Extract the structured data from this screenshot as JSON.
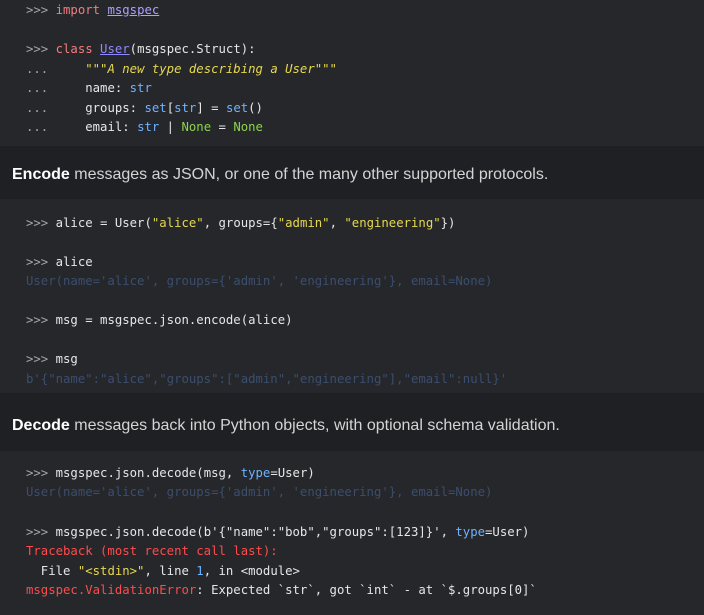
{
  "block1": {
    "l1": [
      ">>> ",
      "import ",
      "msgspec"
    ],
    "l2": [
      ">>> ",
      "class ",
      "User",
      "(msgspec.Struct):"
    ],
    "l3": [
      "...     ",
      "\"\"\"A new type describing a User\"\"\""
    ],
    "l4": [
      "...     ",
      "name: ",
      "str"
    ],
    "l5": [
      "...     ",
      "groups: ",
      "set",
      "[",
      "str",
      "] = ",
      "set",
      "()"
    ],
    "l6": [
      "...     ",
      "email: ",
      "str",
      " | ",
      "None",
      " = ",
      "None"
    ]
  },
  "prose1": {
    "bold": "Encode",
    "rest": " messages as JSON, or one of the many other supported protocols."
  },
  "block2": {
    "l1": [
      ">>> ",
      "alice = User(",
      "\"alice\"",
      ", groups={",
      "\"admin\"",
      ", ",
      "\"engineering\"",
      "})"
    ],
    "l2": [
      ">>> ",
      "alice"
    ],
    "l3": "User(name='alice', groups={'admin', 'engineering'}, email=None)",
    "l4": [
      ">>> ",
      "msg = msgspec.json.encode(alice)"
    ],
    "l5": [
      ">>> ",
      "msg"
    ],
    "l6": "b'{\"name\":\"alice\",\"groups\":[\"admin\",\"engineering\"],\"email\":null}'"
  },
  "prose2": {
    "bold": "Decode",
    "rest": " messages back into Python objects, with optional schema validation."
  },
  "block3": {
    "l1": [
      ">>> ",
      "msgspec.json.decode(msg, ",
      "type",
      "=User)"
    ],
    "l2": "User(name='alice', groups={'admin', 'engineering'}, email=None)",
    "l3": [
      ">>> ",
      "msgspec.json.decode(b'{\"name\":\"bob\",\"groups\":[123]}', ",
      "type",
      "=User)"
    ],
    "l4": "Traceback (most recent call last):",
    "l5": [
      "  File ",
      "\"<stdin>\"",
      ", line ",
      "1",
      ", in <module>"
    ],
    "l6": [
      "msgspec.ValidationError",
      ": Expected `str`, got `int` - at `$.groups[0]`"
    ]
  }
}
